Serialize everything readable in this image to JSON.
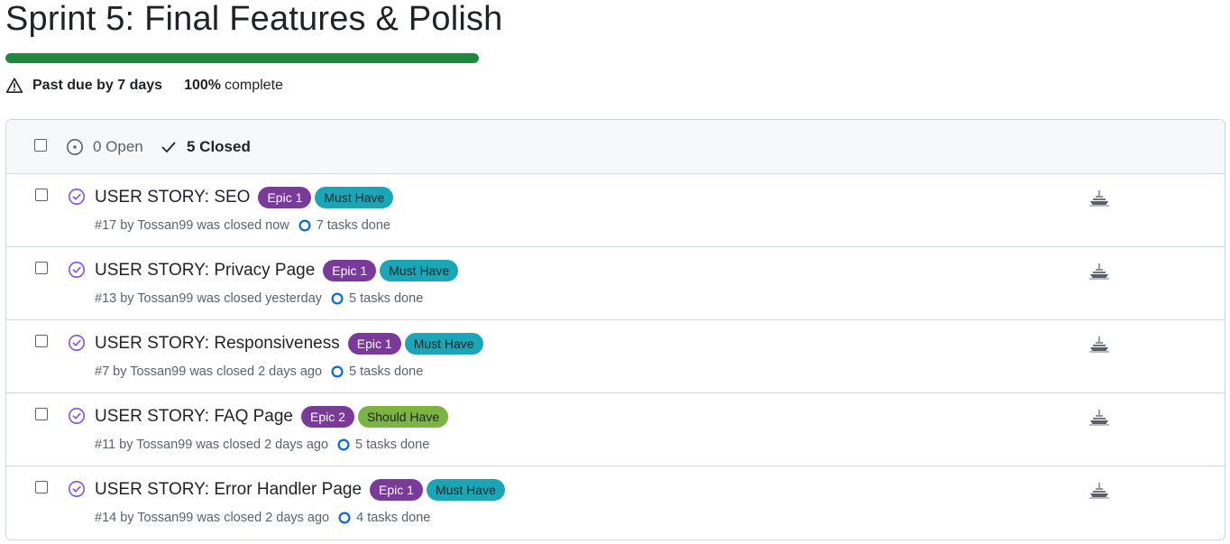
{
  "milestone": {
    "title": "Sprint 5: Final Features & Polish",
    "progress_percent": 100,
    "due_text": "Past due by 7 days",
    "percent_text": "100%",
    "complete_text": "complete",
    "progress_color": "#1f883d"
  },
  "filters": {
    "open_label": "0 Open",
    "closed_label": "5 Closed"
  },
  "colors": {
    "epic_label": "#7a3a9a",
    "must_have_label": "#1aa6b7",
    "should_have_label": "#7cb342",
    "closed_icon": "#8250df",
    "task_ring": "#0969da"
  },
  "issues": [
    {
      "title": "USER STORY: SEO",
      "labels": [
        {
          "text": "Epic 1",
          "kind": "epic"
        },
        {
          "text": "Must Have",
          "kind": "must"
        }
      ],
      "meta": "#17 by Tossan99 was closed now",
      "tasks": "7 tasks done",
      "icon": "closed-issue-icon",
      "assignee_icon": "ship-avatar-icon"
    },
    {
      "title": "USER STORY: Privacy Page",
      "labels": [
        {
          "text": "Epic 1",
          "kind": "epic"
        },
        {
          "text": "Must Have",
          "kind": "must"
        }
      ],
      "meta": "#13 by Tossan99 was closed yesterday",
      "tasks": "5 tasks done",
      "icon": "closed-issue-icon",
      "assignee_icon": "ship-avatar-icon"
    },
    {
      "title": "USER STORY: Responsiveness",
      "labels": [
        {
          "text": "Epic 1",
          "kind": "epic"
        },
        {
          "text": "Must Have",
          "kind": "must"
        }
      ],
      "meta": "#7 by Tossan99 was closed 2 days ago",
      "tasks": "5 tasks done",
      "icon": "closed-issue-icon",
      "assignee_icon": "ship-avatar-icon"
    },
    {
      "title": "USER STORY: FAQ Page",
      "labels": [
        {
          "text": "Epic 2",
          "kind": "epic"
        },
        {
          "text": "Should Have",
          "kind": "should"
        }
      ],
      "meta": "#11 by Tossan99 was closed 2 days ago",
      "tasks": "5 tasks done",
      "icon": "closed-issue-icon",
      "assignee_icon": "ship-avatar-icon"
    },
    {
      "title": "USER STORY: Error Handler Page",
      "labels": [
        {
          "text": "Epic 1",
          "kind": "epic"
        },
        {
          "text": "Must Have",
          "kind": "must"
        }
      ],
      "meta": "#14 by Tossan99 was closed 2 days ago",
      "tasks": "4 tasks done",
      "icon": "closed-issue-icon",
      "assignee_icon": "ship-avatar-icon"
    }
  ]
}
